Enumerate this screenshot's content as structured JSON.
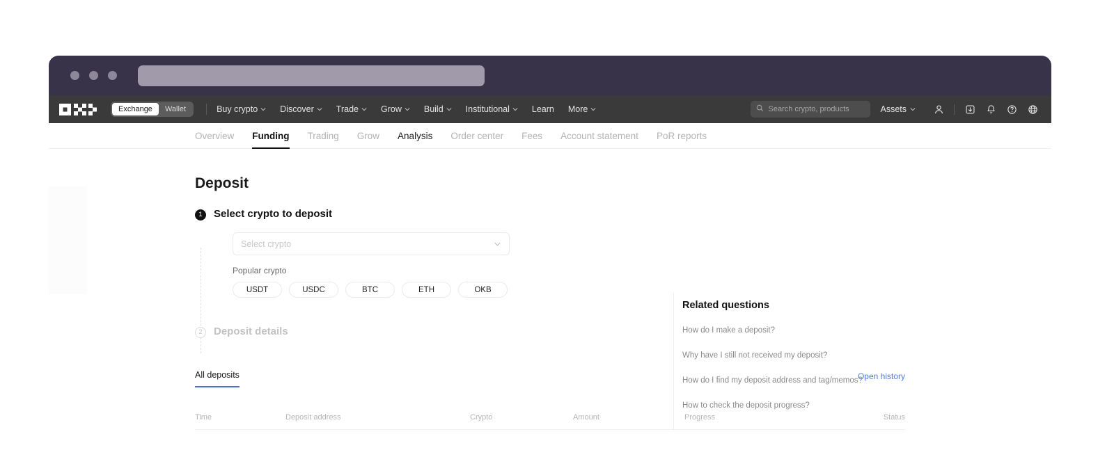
{
  "browser": {
    "traffic_lights": [
      "close",
      "minimize",
      "zoom"
    ],
    "address_value": ""
  },
  "topnav": {
    "logo_name": "OKX",
    "segmented": [
      {
        "label": "Exchange",
        "active": true
      },
      {
        "label": "Wallet",
        "active": false
      }
    ],
    "links": [
      {
        "label": "Buy crypto",
        "caret": true
      },
      {
        "label": "Discover",
        "caret": true
      },
      {
        "label": "Trade",
        "caret": true
      },
      {
        "label": "Grow",
        "caret": true
      },
      {
        "label": "Build",
        "caret": true
      },
      {
        "label": "Institutional",
        "caret": true
      },
      {
        "label": "Learn",
        "caret": false
      },
      {
        "label": "More",
        "caret": true
      }
    ],
    "search_placeholder": "Search crypto, products",
    "assets_label": "Assets",
    "icons": [
      "user-icon",
      "download-icon",
      "bell-icon",
      "help-icon",
      "globe-icon"
    ]
  },
  "subnav": {
    "tabs": [
      {
        "label": "Overview",
        "state": "muted"
      },
      {
        "label": "Funding",
        "state": "active"
      },
      {
        "label": "Trading",
        "state": "muted"
      },
      {
        "label": "Grow",
        "state": "muted"
      },
      {
        "label": "Analysis",
        "state": "dark"
      },
      {
        "label": "Order center",
        "state": "muted"
      },
      {
        "label": "Fees",
        "state": "muted"
      },
      {
        "label": "Account statement",
        "state": "muted"
      },
      {
        "label": "PoR reports",
        "state": "muted"
      }
    ]
  },
  "main": {
    "page_title": "Deposit",
    "step1": {
      "number": "1",
      "title": "Select crypto to deposit",
      "select_placeholder": "Select crypto",
      "popular_label": "Popular crypto",
      "chips": [
        "USDT",
        "USDC",
        "BTC",
        "ETH",
        "OKB"
      ]
    },
    "step2": {
      "number": "2",
      "title": "Deposit details"
    }
  },
  "related_questions": {
    "title": "Related questions",
    "items": [
      "How do I make a deposit?",
      "Why have I still not received my deposit?",
      "How do I find my deposit address and tag/memos?",
      "How to check the deposit progress?"
    ]
  },
  "deposits": {
    "tab_label": "All deposits",
    "open_history_label": "Open history",
    "columns": [
      "Time",
      "Deposit address",
      "Crypto",
      "Amount",
      "Progress",
      "Status"
    ],
    "rows": []
  },
  "colors": {
    "titlebar": "#393349",
    "topnav": "#3a3a3a",
    "accent_link": "#5379dd",
    "tab_underline": "#4a72d4",
    "text_primary": "#121212",
    "text_muted": "#b3b3b3"
  }
}
